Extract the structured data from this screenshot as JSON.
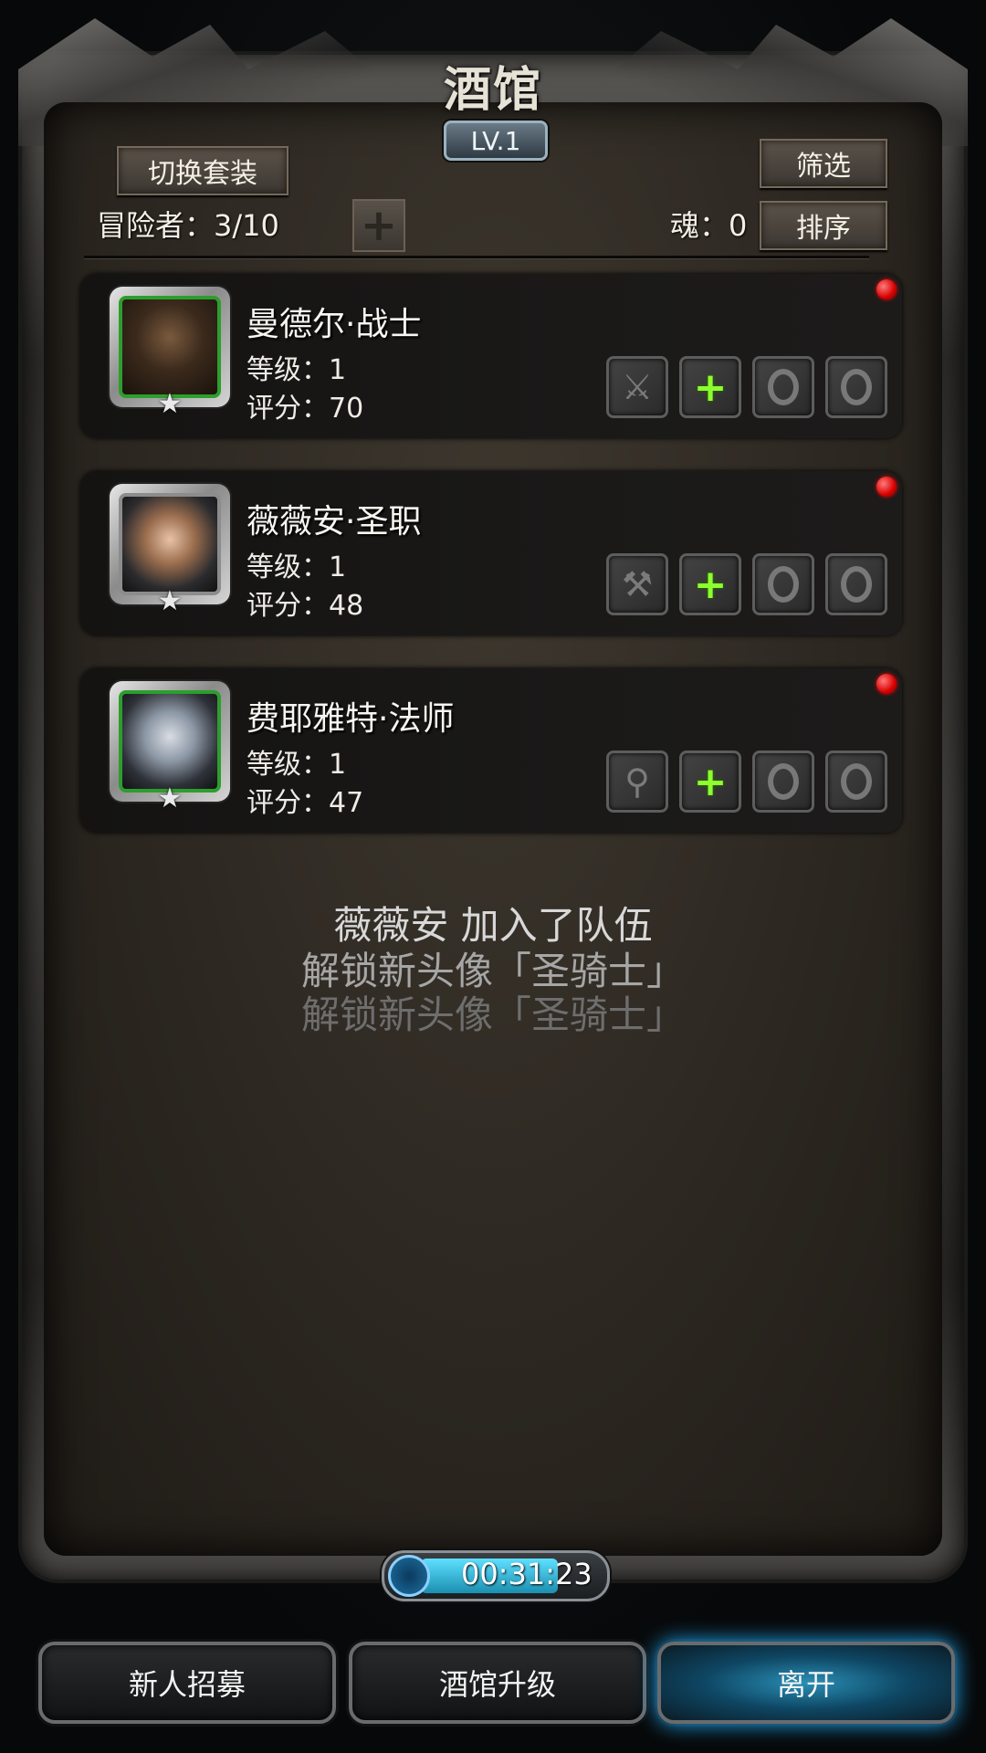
{
  "title": "酒馆",
  "level_badge": "LV.1",
  "buttons": {
    "switch_outfit": "切换套装",
    "filter": "筛选",
    "sort": "排序",
    "add": "+"
  },
  "stats": {
    "adventurers": "冒险者：3/10",
    "soul": "魂：0"
  },
  "characters": [
    {
      "name": "曼德尔·战士",
      "level": "等级：1",
      "score": "评分：70",
      "weapon_icon": "sword-icon"
    },
    {
      "name": "薇薇安·圣职",
      "level": "等级：1",
      "score": "评分：48",
      "weapon_icon": "hammer-icon"
    },
    {
      "name": "费耶雅特·法师",
      "level": "等级：1",
      "score": "评分：47",
      "weapon_icon": "staff-icon"
    }
  ],
  "messages": [
    {
      "text": "薇薇安 加入了队伍",
      "color": "#d8d8d8"
    },
    {
      "text": "解锁新头像「圣骑士」",
      "color": "#a6a6a6"
    },
    {
      "text": "解锁新头像「圣骑士」",
      "color": "#6e6e6e"
    }
  ],
  "timer": "00:31:23",
  "bottom_buttons": {
    "recruit": "新人招募",
    "upgrade": "酒馆升级",
    "leave": "离开"
  },
  "colors": {
    "accent_green": "#8dff2e",
    "notify_red": "#d80000",
    "glow_blue": "#1fb0ff"
  }
}
